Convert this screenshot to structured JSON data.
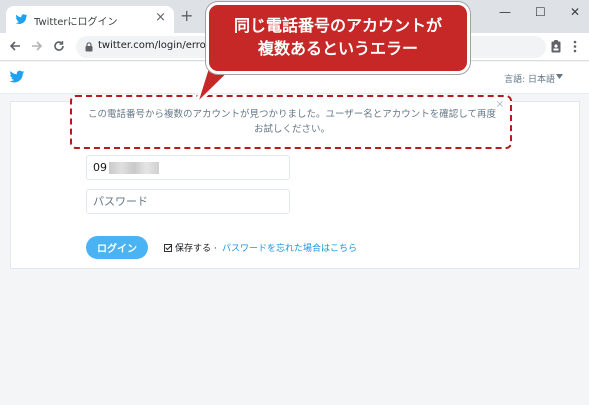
{
  "browser": {
    "tab_title": "Twitterにログイン",
    "tab_close": "×",
    "new_tab": "+",
    "url": "twitter.com/login/error?",
    "window_controls": [
      "—",
      "☐",
      "✕"
    ]
  },
  "header": {
    "language": "言語: 日本語"
  },
  "alert": {
    "message": "この電話番号から複数のアカウントが見つかりました。ユーザー名とアカウントを確認して再度お試しください。",
    "close": "×"
  },
  "form": {
    "phone_visible": "09",
    "password_placeholder": "パスワード",
    "login_label": "ログイン",
    "remember_label": "保存する",
    "separator": "·",
    "forgot_label": "パスワードを忘れた場合はこちら"
  },
  "callout": {
    "line1": "同じ電話番号のアカウントが",
    "line2": "複数あるというエラー"
  },
  "colors": {
    "twitter_blue": "#1da1f2",
    "button_blue": "#4ab3f4",
    "callout_red": "#c62828",
    "link_blue": "#1b95e0"
  },
  "icons": [
    "twitter-bird-icon",
    "back-arrow-icon",
    "forward-arrow-icon",
    "reload-icon",
    "lock-icon",
    "extension-icon",
    "menu-icon",
    "checkbox-icon"
  ]
}
